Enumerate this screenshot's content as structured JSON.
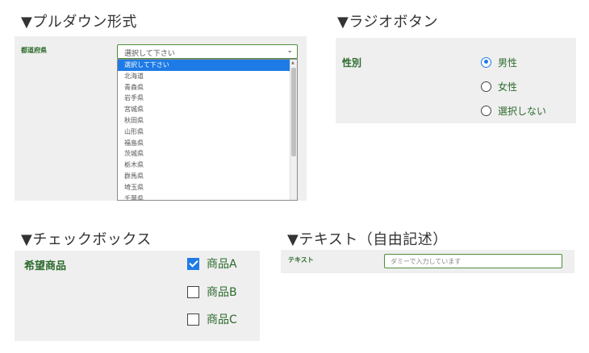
{
  "dropdown_section": {
    "heading": "▼プルダウン形式",
    "field_label": "都道府県",
    "selected_value": "選択して下さい",
    "options": [
      "選択して下さい",
      "北海道",
      "青森県",
      "岩手県",
      "宮城県",
      "秋田県",
      "山形県",
      "福島県",
      "茨城県",
      "栃木県",
      "群馬県",
      "埼玉県",
      "千葉県"
    ],
    "highlighted_option": "選択して下さい"
  },
  "radio_section": {
    "heading": "▼ラジオボタン",
    "field_label": "性別",
    "options": [
      {
        "label": "男性",
        "checked": true
      },
      {
        "label": "女性",
        "checked": false
      },
      {
        "label": "選択しない",
        "checked": false
      }
    ]
  },
  "checkbox_section": {
    "heading": "▼チェックボックス",
    "field_label": "希望商品",
    "options": [
      {
        "label": "商品A",
        "checked": true
      },
      {
        "label": "商品B",
        "checked": false
      },
      {
        "label": "商品C",
        "checked": false
      }
    ]
  },
  "text_section": {
    "heading": "▼テキスト（自由記述）",
    "field_label": "テキスト",
    "placeholder": "ダミーで入力しています"
  },
  "colors": {
    "label_green": "#2d6b2d",
    "border_green": "#4f8d3e",
    "accent_blue": "#1e7be6",
    "panel_gray": "#efefef"
  }
}
